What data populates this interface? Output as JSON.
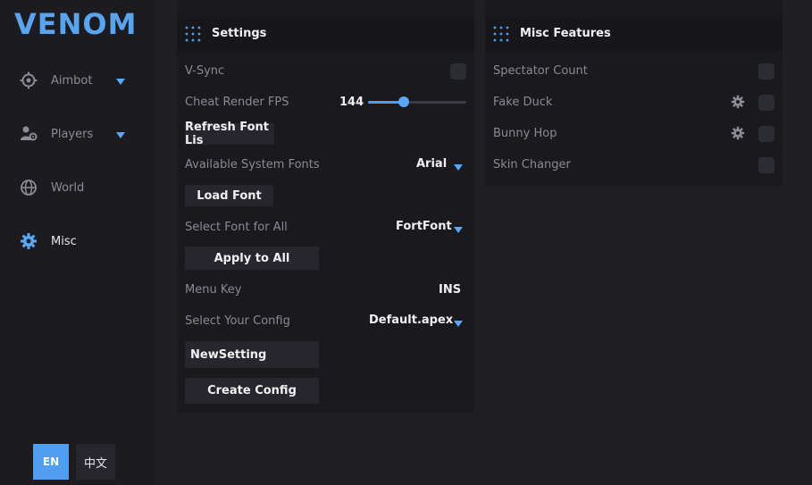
{
  "app": {
    "logo": "VENOM"
  },
  "sidebar": {
    "items": [
      {
        "label": "Aimbot",
        "icon": "crosshair-icon",
        "has_caret": true
      },
      {
        "label": "Players",
        "icon": "players-icon",
        "has_caret": true
      },
      {
        "label": "World",
        "icon": "globe-icon",
        "has_caret": false
      },
      {
        "label": "Misc",
        "icon": "gear-icon",
        "active": true,
        "has_caret": false
      }
    ],
    "languages": {
      "en": "EN",
      "zh": "中文",
      "selected": "EN"
    }
  },
  "settings": {
    "title": "Settings",
    "vsync_label": "V-Sync",
    "fps_label": "Cheat Render FPS",
    "fps_value": "144",
    "fps_slider_fraction": 0.36,
    "refresh_fonts_button": "Refresh Font Lis",
    "available_fonts_label": "Available System Fonts",
    "available_fonts_value": "Arial",
    "load_font_button": "Load Font",
    "select_font_label": "Select Font for All",
    "select_font_value": "FortFont",
    "apply_all_button": "Apply to All",
    "menu_key_label": "Menu Key",
    "menu_key_value": "INS",
    "config_label": "Select Your Config",
    "config_value": "Default.apex",
    "new_setting_value": "NewSetting",
    "create_config_button": "Create Config"
  },
  "misc_features": {
    "title": "Misc Features",
    "items": [
      {
        "label": "Spectator Count",
        "has_gear": false
      },
      {
        "label": "Fake Duck",
        "has_gear": true
      },
      {
        "label": "Bunny Hop",
        "has_gear": true
      },
      {
        "label": "Skin Changer",
        "has_gear": false
      }
    ]
  },
  "colors": {
    "accent": "#4f9ef0",
    "background": "#1c1c21",
    "panel": "#19191e",
    "control": "#26262c"
  }
}
